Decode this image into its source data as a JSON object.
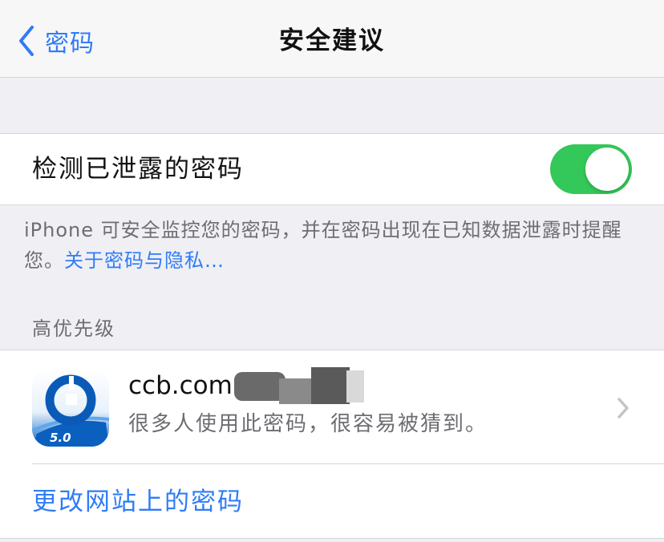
{
  "nav": {
    "back_label": "密码",
    "title": "安全建议"
  },
  "detect_toggle": {
    "label": "检测已泄露的密码",
    "is_on": true,
    "on_color": "#34c759"
  },
  "footer_note": {
    "text": "iPhone 可安全监控您的密码，并在密码出现在已知数据泄露时提醒您。",
    "link": "关于密码与隐私…"
  },
  "section": {
    "header": "高优先级"
  },
  "entry": {
    "site": "ccb.com",
    "warning": "很多人使用此密码，很容易被猜到。",
    "app_icon": "ccb-bank-app-icon",
    "icon_badge": "5.0"
  },
  "action": {
    "label": "更改网站上的密码"
  },
  "colors": {
    "accent": "#2f7cf6",
    "background": "#efeff4",
    "text_secondary": "#6d6d72"
  }
}
